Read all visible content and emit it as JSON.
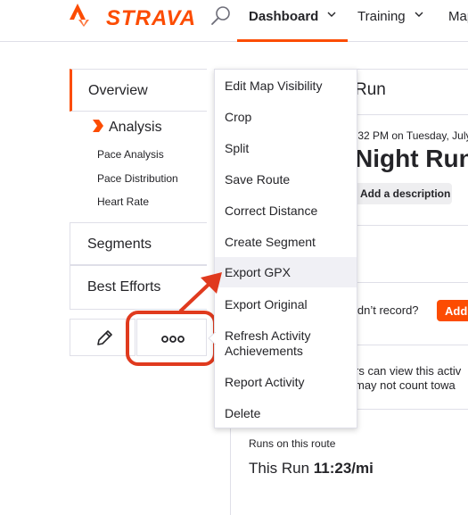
{
  "header": {
    "logo": "STRAVA",
    "nav": [
      {
        "label": "Dashboard"
      },
      {
        "label": "Training"
      },
      {
        "label": "Map"
      }
    ]
  },
  "sidebar": {
    "overview": "Overview",
    "analysis": "Analysis",
    "sub_items": [
      "Pace Analysis",
      "Pace Distribution",
      "Heart Rate"
    ],
    "segments": "Segments",
    "best_efforts": "Best Efforts"
  },
  "menu": {
    "items": [
      "Edit Map Visibility",
      "Crop",
      "Split",
      "Save Route",
      "Correct Distance",
      "Create Segment",
      "Export GPX",
      "Export Original",
      "Refresh Activity",
      "Achievements",
      "Report Activity",
      "Delete"
    ],
    "highlighted": "Export GPX"
  },
  "main": {
    "title": "Run",
    "date": ":32 PM on Tuesday, July",
    "activity_name": "Night Run",
    "add_description": "Add a description",
    "didnt_record": "idn’t record?",
    "add_button": "Add",
    "privacy_line1": "rs can view this activ",
    "privacy_line2": "may not count towa",
    "runs_on_route": "Runs on this route",
    "this_run_label": "This Run",
    "this_run_pace": "11:23/mi"
  },
  "colors": {
    "brand": "#fc4c02",
    "annotation": "#e03a1e",
    "hover": "#f0f0f5"
  }
}
